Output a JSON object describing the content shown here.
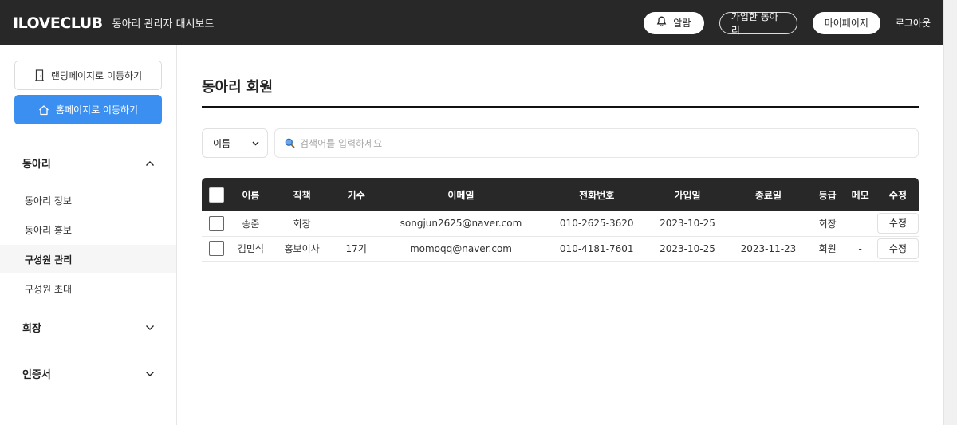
{
  "header": {
    "brand": "ILOVECLUB",
    "subtitle": "동아리 관리자 대시보드",
    "alarm_label": "알람",
    "joined_clubs_label": "가입한 동아리",
    "mypage_label": "마이페이지",
    "logout_label": "로그아웃"
  },
  "sidebar": {
    "landing_button": "랜딩페이지로 이동하기",
    "home_button": "홈페이지로 이동하기",
    "sections": [
      {
        "title": "동아리",
        "expanded": true,
        "items": [
          "동아리 정보",
          "동아리 홍보",
          "구성원 관리",
          "구성원 초대"
        ],
        "active_item": "구성원 관리"
      },
      {
        "title": "회장",
        "expanded": false
      },
      {
        "title": "인증서",
        "expanded": false
      }
    ]
  },
  "main": {
    "title": "동아리 회원",
    "filter_selected": "이름",
    "search_placeholder": "검색어를 입력하세요",
    "table": {
      "columns": [
        "이름",
        "직책",
        "기수",
        "이메일",
        "전화번호",
        "가입일",
        "종료일",
        "등급",
        "메모",
        "수정"
      ],
      "rows": [
        {
          "name": "송준",
          "role": "회장",
          "gen": "",
          "email": "songjun2625@naver.com",
          "phone": "010-2625-3620",
          "joined": "2023-10-25",
          "ended": "",
          "grade": "회장",
          "memo": "",
          "edit": "수정"
        },
        {
          "name": "김민석",
          "role": "홍보이사",
          "gen": "17기",
          "email": "momoqq@naver.com",
          "phone": "010-4181-7601",
          "joined": "2023-10-25",
          "ended": "2023-11-23",
          "grade": "회원",
          "memo": "-",
          "edit": "수정"
        }
      ]
    }
  },
  "colors": {
    "header_bg": "#282828",
    "primary": "#3a8ff0"
  }
}
